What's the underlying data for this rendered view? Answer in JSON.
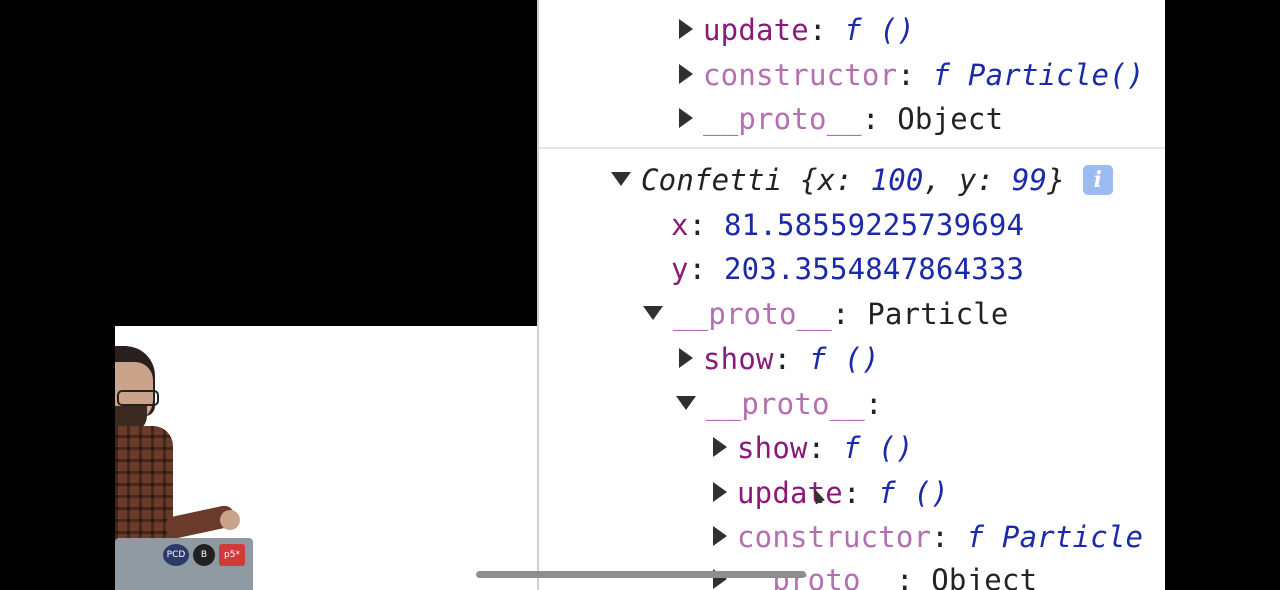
{
  "console": {
    "rows": [
      {
        "indent": 0,
        "expanded": false,
        "key": "update",
        "key_style": "own",
        "value_fn": "f ()",
        "value_plain": ""
      },
      {
        "indent": 0,
        "expanded": false,
        "key": "constructor",
        "key_style": "proto",
        "value_fn": "f Particle()",
        "value_plain": ""
      },
      {
        "indent": 0,
        "expanded": false,
        "key": "__proto__",
        "key_style": "proto",
        "value_fn": "",
        "value_plain": "Object"
      }
    ],
    "object": {
      "class_name": "Confetti",
      "preview_open": "{x: ",
      "preview_x": "100",
      "preview_mid": ", y: ",
      "preview_y": "99",
      "preview_close": "}",
      "info_icon": "i",
      "x_key": "x",
      "x_value": "81.58559225739694",
      "y_key": "y",
      "y_value": "203.3554847864333",
      "proto_key": "__proto__",
      "proto_value": "Particle",
      "show_key": "show",
      "show_value": "f ()",
      "inner_proto_key": "__proto__",
      "inner_show_key": "show",
      "inner_show_value": "f ()",
      "inner_update_key": "update",
      "inner_update_value": "f ()",
      "inner_constructor_key": "constructor",
      "inner_constructor_value": "f Particle",
      "inner_last_key": "__proto__",
      "inner_last_value": "Object"
    }
  },
  "colors": {
    "own_key": "#8a1a7a",
    "proto_key": "#b46fb1",
    "number": "#1a2aa8"
  },
  "stickers": [
    "PCD",
    "B",
    "p5*"
  ]
}
